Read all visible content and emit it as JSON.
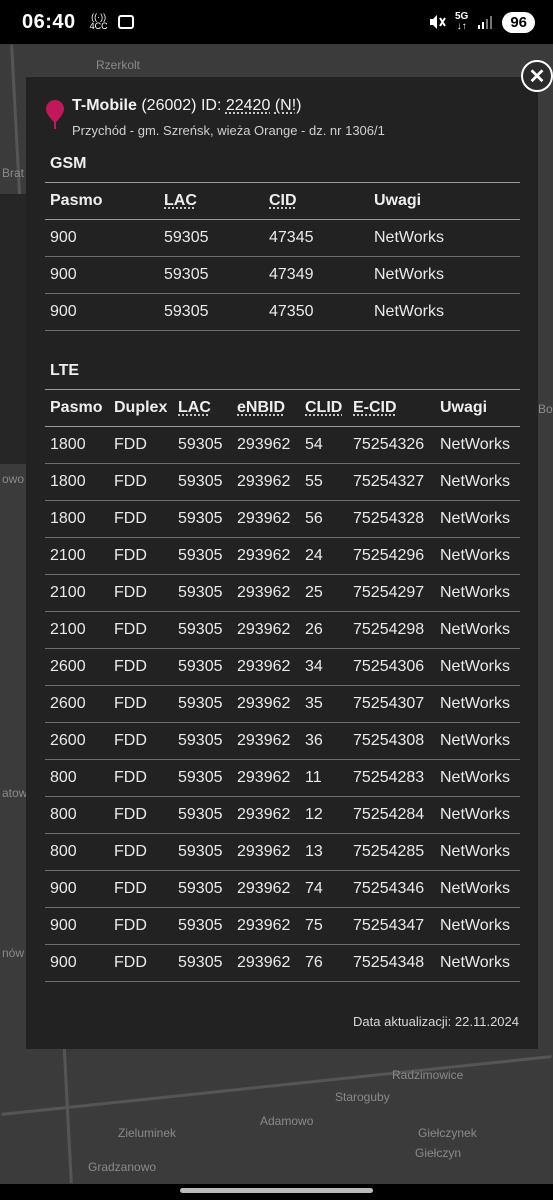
{
  "status": {
    "time": "06:40",
    "cc_icon_text": "4CC",
    "network": "5G",
    "battery": "96"
  },
  "map": {
    "labels": [
      "Rzerkolt",
      "Brat",
      "owo",
      "atow",
      "nów",
      "Radzimowice",
      "Staroguby",
      "Adamowo",
      "Zieluminek",
      "Giełczynek",
      "Giełczyn",
      "Gradzanowo",
      "Bo"
    ]
  },
  "popup": {
    "operator": "T-Mobile",
    "network_code": "(26002)",
    "id_label": "ID:",
    "id_value": "22420",
    "flag": "(N!)",
    "address": "Przychód - gm. Szreńsk, wieża Orange - dz. nr 1306/1",
    "gsm": {
      "title": "GSM",
      "headers": [
        "Pasmo",
        "LAC",
        "CID",
        "Uwagi"
      ],
      "rows": [
        [
          "900",
          "59305",
          "47345",
          "NetWorks"
        ],
        [
          "900",
          "59305",
          "47349",
          "NetWorks"
        ],
        [
          "900",
          "59305",
          "47350",
          "NetWorks"
        ]
      ]
    },
    "lte": {
      "title": "LTE",
      "headers": [
        "Pasmo",
        "Duplex",
        "LAC",
        "eNBID",
        "CLID",
        "E-CID",
        "Uwagi"
      ],
      "rows": [
        [
          "1800",
          "FDD",
          "59305",
          "293962",
          "54",
          "75254326",
          "NetWorks"
        ],
        [
          "1800",
          "FDD",
          "59305",
          "293962",
          "55",
          "75254327",
          "NetWorks"
        ],
        [
          "1800",
          "FDD",
          "59305",
          "293962",
          "56",
          "75254328",
          "NetWorks"
        ],
        [
          "2100",
          "FDD",
          "59305",
          "293962",
          "24",
          "75254296",
          "NetWorks"
        ],
        [
          "2100",
          "FDD",
          "59305",
          "293962",
          "25",
          "75254297",
          "NetWorks"
        ],
        [
          "2100",
          "FDD",
          "59305",
          "293962",
          "26",
          "75254298",
          "NetWorks"
        ],
        [
          "2600",
          "FDD",
          "59305",
          "293962",
          "34",
          "75254306",
          "NetWorks"
        ],
        [
          "2600",
          "FDD",
          "59305",
          "293962",
          "35",
          "75254307",
          "NetWorks"
        ],
        [
          "2600",
          "FDD",
          "59305",
          "293962",
          "36",
          "75254308",
          "NetWorks"
        ],
        [
          "800",
          "FDD",
          "59305",
          "293962",
          "11",
          "75254283",
          "NetWorks"
        ],
        [
          "800",
          "FDD",
          "59305",
          "293962",
          "12",
          "75254284",
          "NetWorks"
        ],
        [
          "800",
          "FDD",
          "59305",
          "293962",
          "13",
          "75254285",
          "NetWorks"
        ],
        [
          "900",
          "FDD",
          "59305",
          "293962",
          "74",
          "75254346",
          "NetWorks"
        ],
        [
          "900",
          "FDD",
          "59305",
          "293962",
          "75",
          "75254347",
          "NetWorks"
        ],
        [
          "900",
          "FDD",
          "59305",
          "293962",
          "76",
          "75254348",
          "NetWorks"
        ]
      ]
    },
    "footer": "Data aktualizacji: 22.11.2024",
    "close_icon": "close-icon"
  },
  "colors": {
    "popup_bg": "#222222",
    "pin": "#c2185b"
  }
}
